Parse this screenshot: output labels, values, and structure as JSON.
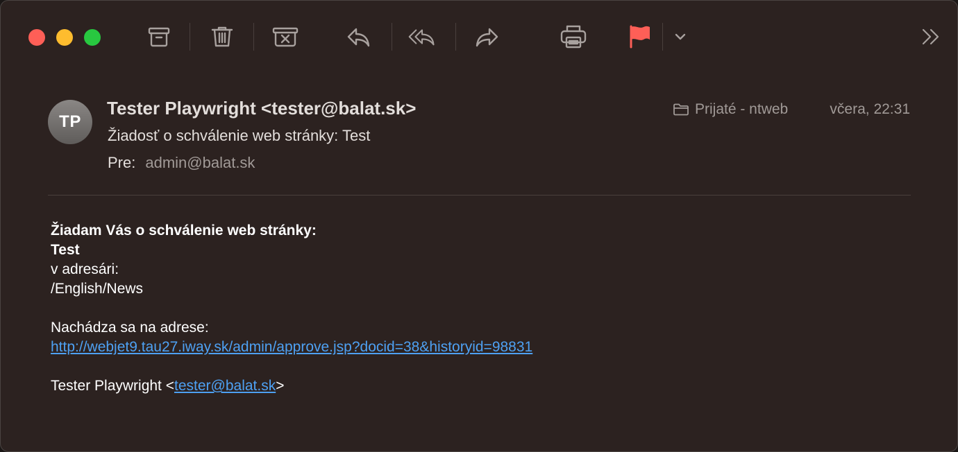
{
  "toolbar": {
    "icons": [
      "archive-icon",
      "trash-icon",
      "junk-icon",
      "reply-icon",
      "reply-all-icon",
      "forward-icon",
      "print-icon",
      "flag-icon",
      "chevron-down-icon",
      "more-chevrons-icon"
    ],
    "flag_color": "#fe5f57"
  },
  "message": {
    "avatar_initials": "TP",
    "sender": "Tester Playwright <tester@balat.sk>",
    "subject": "Žiadosť o schválenie web stránky: Test",
    "to_label": "Pre:",
    "to_value": "admin@balat.sk",
    "mailbox": "Prijaté - ntweb",
    "date": "včera, 22:31"
  },
  "body": {
    "heading": "Žiadam Vás o schválenie web stránky:",
    "page_name": "Test",
    "in_folder_label": "v adresári:",
    "folder_path": "/English/News",
    "address_label": "Nachádza sa na adrese:",
    "approve_url": "http://webjet9.tau27.iway.sk/admin/approve.jsp?docid=38&historyid=98831",
    "signature_name": "Tester Playwright <",
    "signature_email": "tester@balat.sk",
    "signature_end": ">"
  },
  "colors": {
    "background": "#2c2220",
    "link": "#4ea1f3",
    "close": "#fe5f57",
    "minimize": "#febc2e",
    "maximize": "#28c840"
  }
}
